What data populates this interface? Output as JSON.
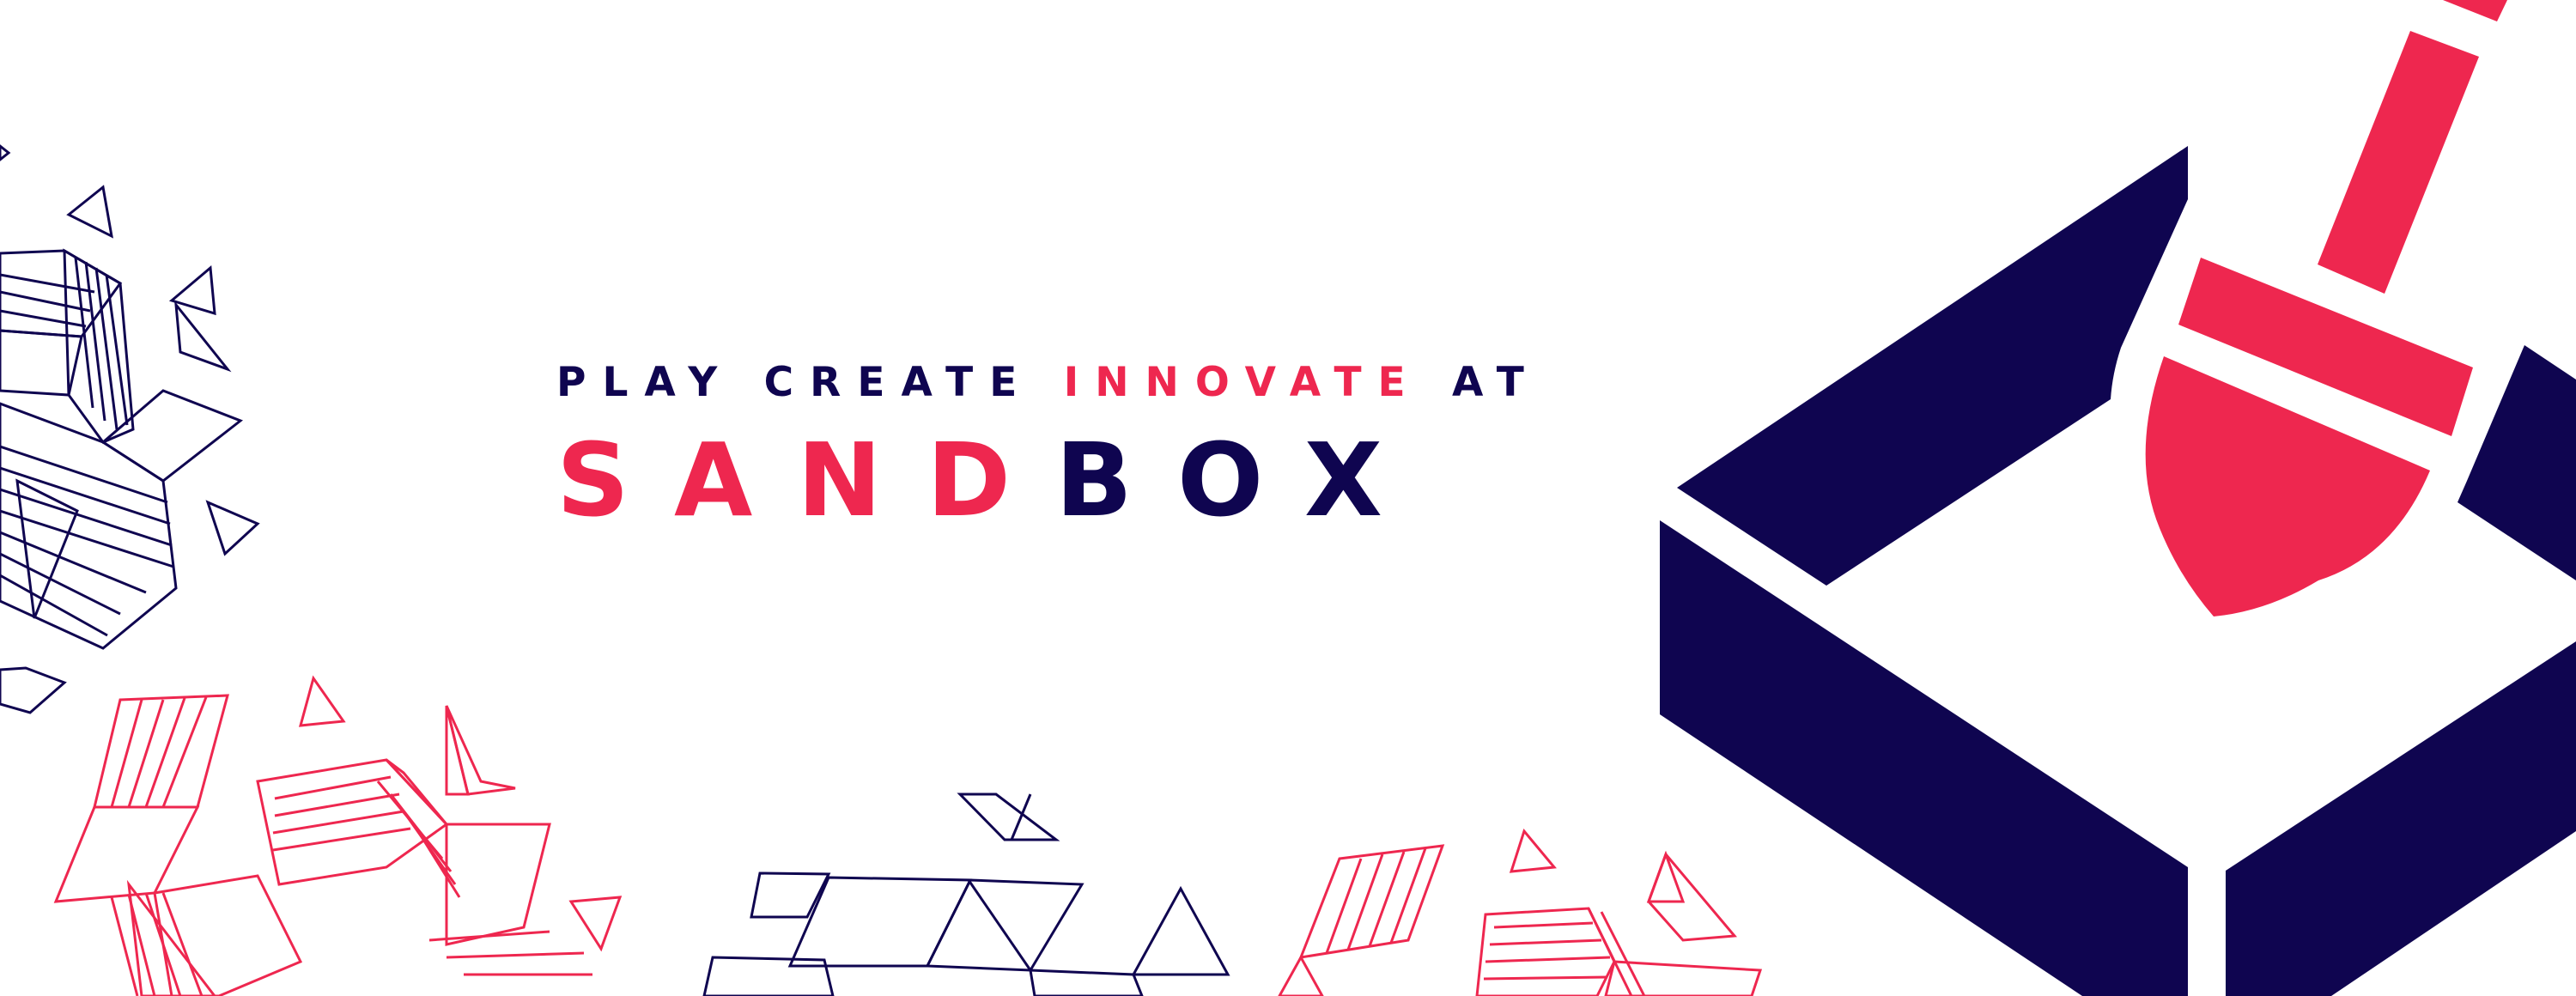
{
  "tagline": {
    "part1": "PLAY CREATE ",
    "part2": "INNOVATE",
    "part3": " AT"
  },
  "brand": {
    "part1": "SAND",
    "part2": "BOX"
  },
  "colors": {
    "navy": "#0f0550",
    "pink": "#ee274f",
    "background": "#ffffff"
  },
  "icons": {
    "logo": "sandbox-with-shovel-icon",
    "decoration": "isometric-geometric-pattern"
  }
}
